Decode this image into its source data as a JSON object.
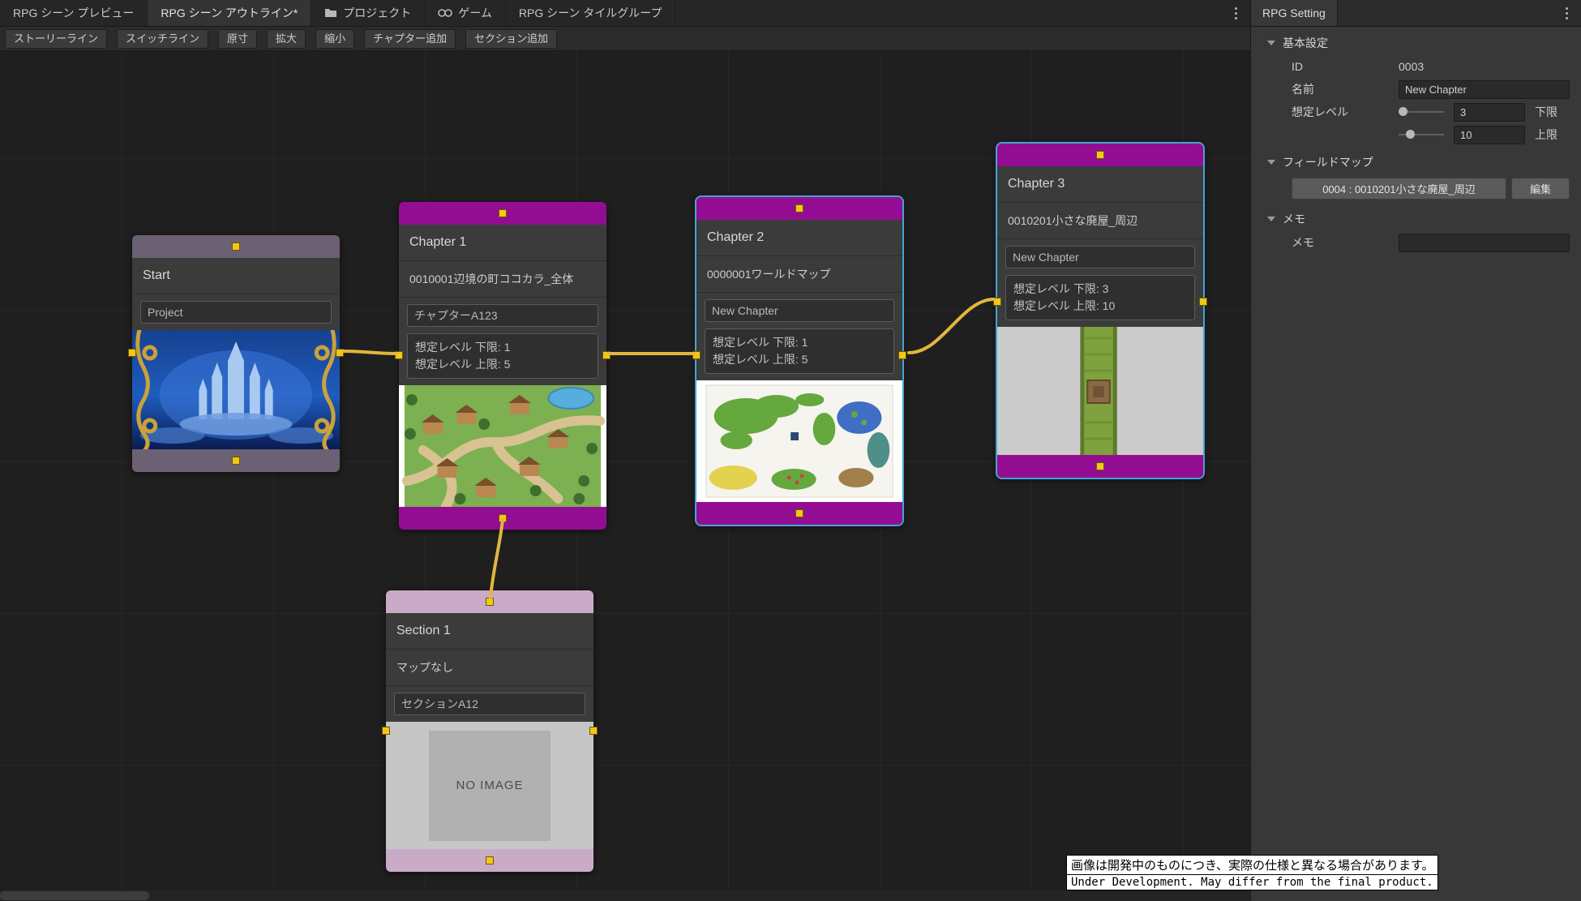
{
  "tab_bar": {
    "tabs": [
      {
        "label": "RPG シーン プレビュー"
      },
      {
        "label": "RPG シーン アウトライン*"
      },
      {
        "label": "プロジェクト"
      },
      {
        "label": "ゲーム"
      },
      {
        "label": "RPG シーン タイルグループ"
      }
    ]
  },
  "toolbar": {
    "buttons": [
      "ストーリーライン",
      "スイッチライン",
      "原寸",
      "拡大",
      "縮小",
      "チャプター追加",
      "セクション追加"
    ]
  },
  "graph": {
    "start": {
      "title": "Start",
      "field": "Project"
    },
    "chapter1": {
      "title": "Chapter 1",
      "map_name": "0010001辺境の町ココカラ_全体",
      "field": "チャプターA123",
      "level_lines": [
        "想定レベル 下限: 1",
        "想定レベル 上限: 5"
      ]
    },
    "chapter2": {
      "title": "Chapter 2",
      "map_name": "0000001ワールドマップ",
      "field": "New Chapter",
      "level_lines": [
        "想定レベル 下限: 1",
        "想定レベル 上限: 5"
      ]
    },
    "chapter3": {
      "title": "Chapter 3",
      "map_name": "0010201小さな廃屋_周辺",
      "field": "New Chapter",
      "level_lines": [
        "想定レベル 下限: 3",
        "想定レベル 上限: 10"
      ]
    },
    "section1": {
      "title": "Section 1",
      "map_name": "マップなし",
      "field": "セクションA12",
      "no_image": "NO IMAGE"
    }
  },
  "inspector": {
    "tab": "RPG Setting",
    "basic": {
      "title": "基本設定",
      "id_label": "ID",
      "id_value": "0003",
      "name_label": "名前",
      "name_value": "New Chapter",
      "level_label": "想定レベル",
      "min_value": "3",
      "min_suffix": "下限",
      "max_value": "10",
      "max_suffix": "上限"
    },
    "field_map": {
      "title": "フィールドマップ",
      "map_button": "0004 : 0010201小さな廃屋_周辺",
      "edit_button": "編集"
    },
    "memo": {
      "title": "メモ",
      "label": "メモ",
      "value": ""
    }
  },
  "notice": {
    "line1": "画像は開発中のものにつき、実際の仕様と異なる場合があります。",
    "line2": "Under Development. May differ from the final product."
  }
}
